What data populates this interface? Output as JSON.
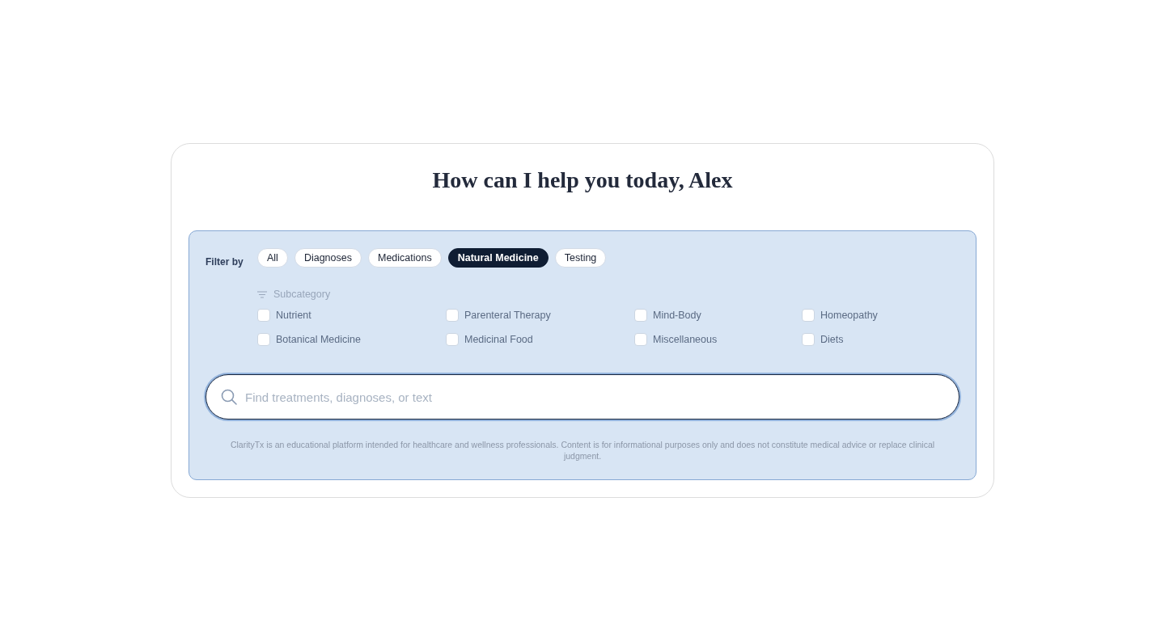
{
  "heading": "How can I help you today, Alex",
  "filter": {
    "label": "Filter by",
    "options": [
      {
        "label": "All",
        "selected": false
      },
      {
        "label": "Diagnoses",
        "selected": false
      },
      {
        "label": "Medications",
        "selected": false
      },
      {
        "label": "Natural Medicine",
        "selected": true
      },
      {
        "label": "Testing",
        "selected": false
      }
    ]
  },
  "subcategory": {
    "label": "Subcategory",
    "items": [
      {
        "label": "Nutrient",
        "checked": false
      },
      {
        "label": "Parenteral Therapy",
        "checked": false
      },
      {
        "label": "Mind-Body",
        "checked": false
      },
      {
        "label": "Homeopathy",
        "checked": false
      },
      {
        "label": "Botanical Medicine",
        "checked": false
      },
      {
        "label": "Medicinal Food",
        "checked": false
      },
      {
        "label": "Miscellaneous",
        "checked": false
      },
      {
        "label": "Diets",
        "checked": false
      }
    ]
  },
  "search": {
    "placeholder": "Find treatments, diagnoses, or text"
  },
  "disclaimer": "ClarityTx is an educational platform intended for healthcare and wellness professionals. Content is for informational purposes only and does not constitute medical advice or replace clinical judgment."
}
